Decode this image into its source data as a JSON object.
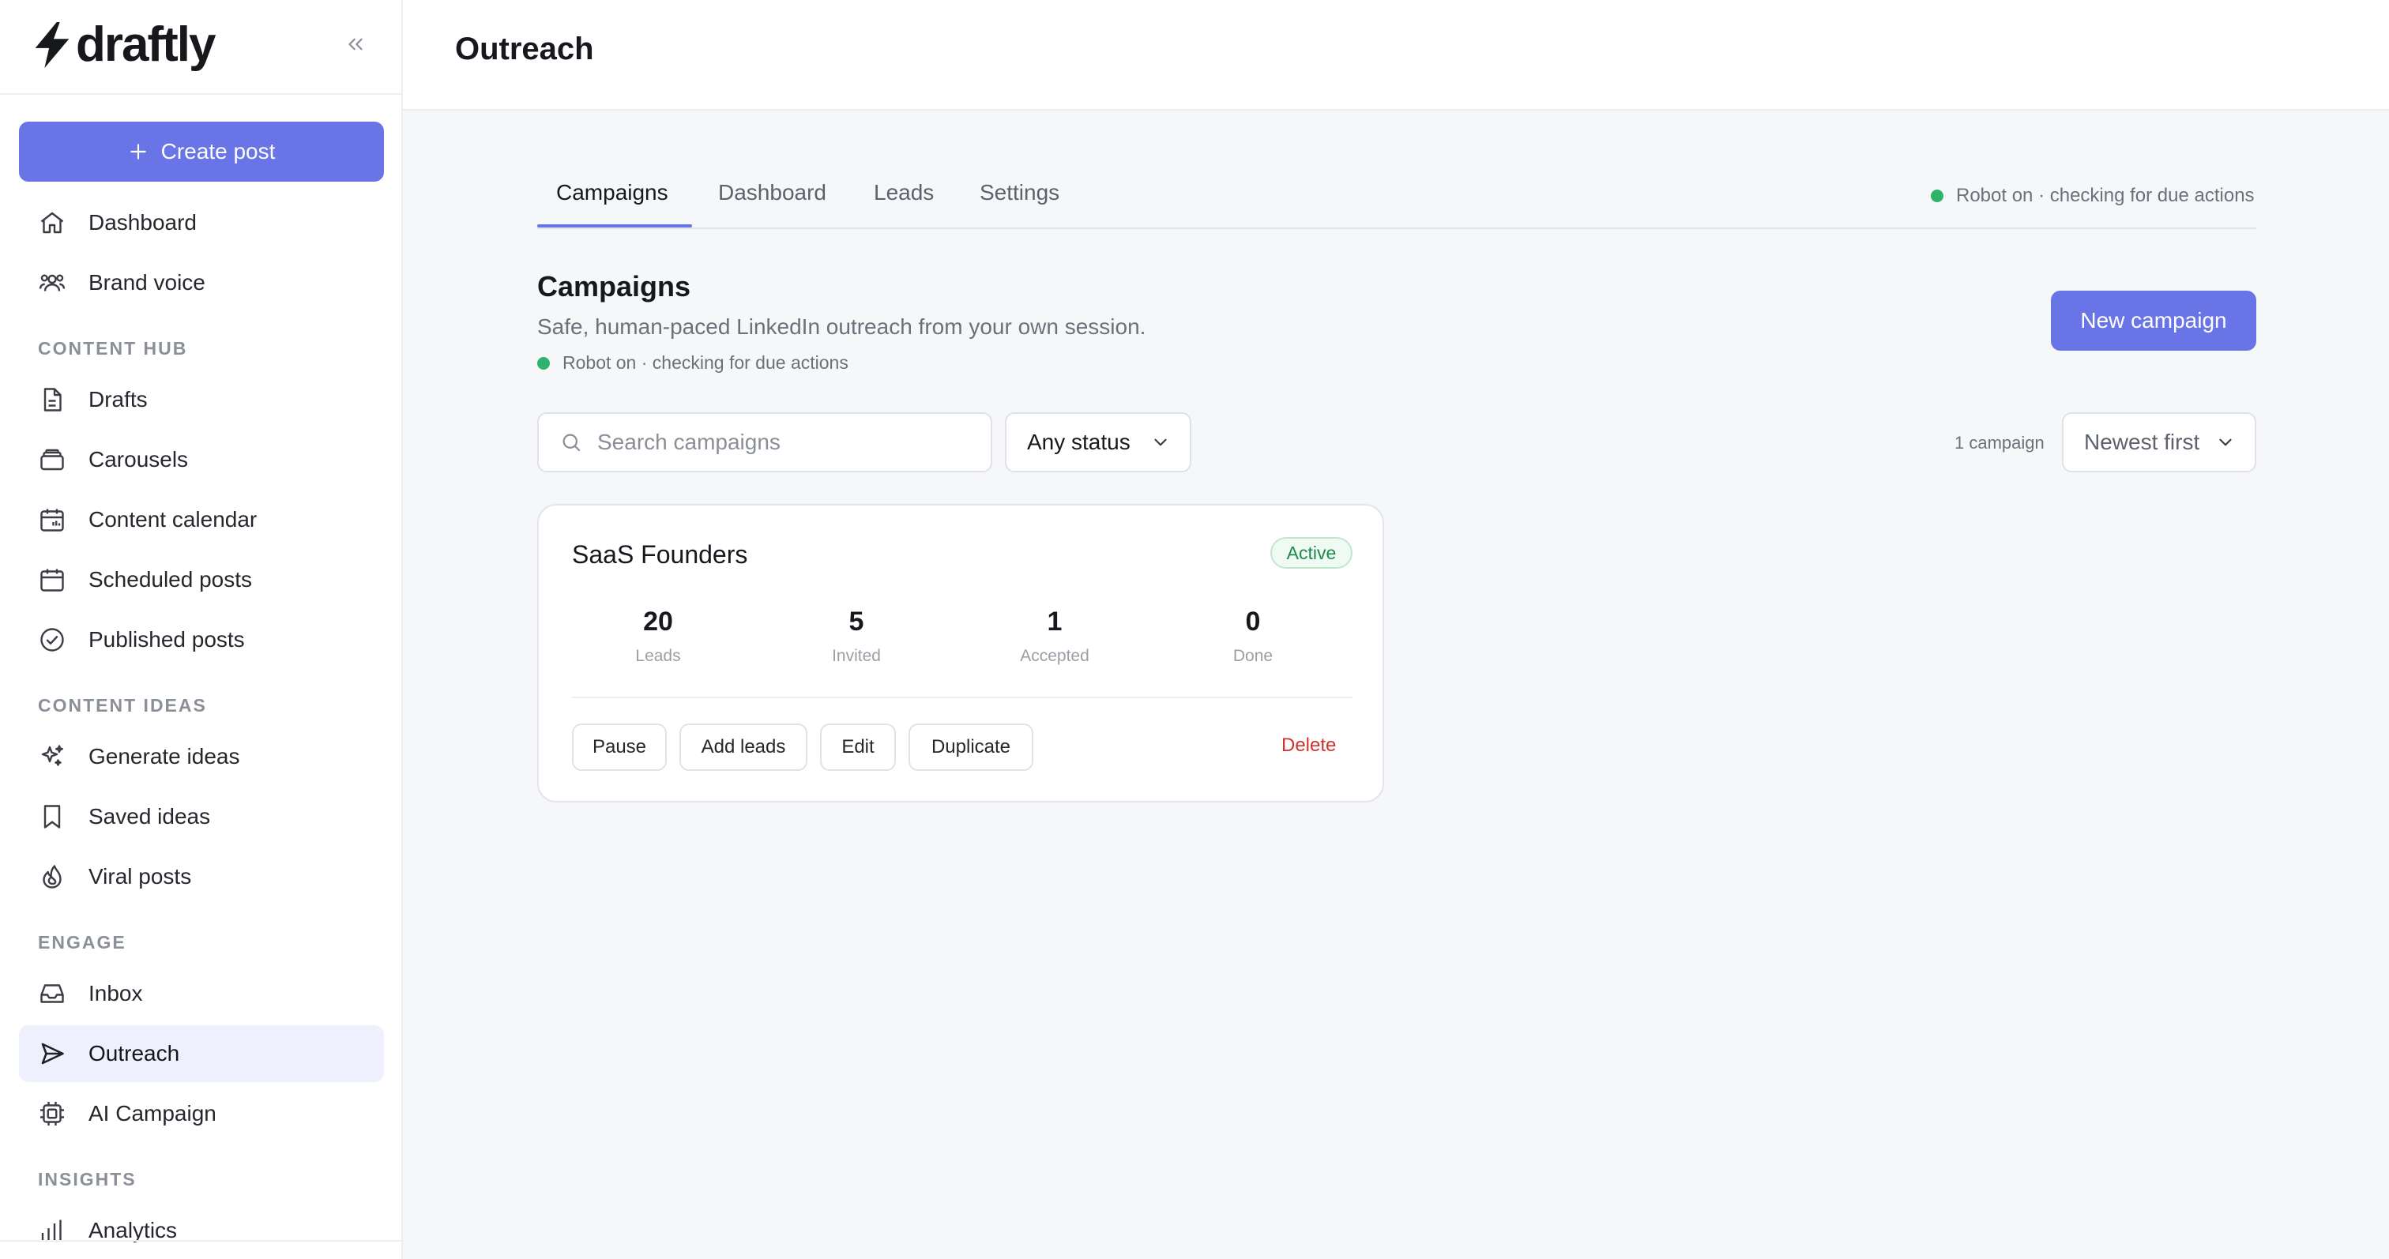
{
  "app": {
    "logo_text": "draftly"
  },
  "sidebar": {
    "create_label": "Create post",
    "top_items": [
      {
        "label": "Dashboard",
        "icon": "home-icon"
      },
      {
        "label": "Brand voice",
        "icon": "users-icon"
      }
    ],
    "sections": [
      {
        "title": "CONTENT HUB",
        "items": [
          {
            "label": "Drafts",
            "icon": "document-icon"
          },
          {
            "label": "Carousels",
            "icon": "layers-icon"
          },
          {
            "label": "Content calendar",
            "icon": "calendar-grid-icon"
          },
          {
            "label": "Scheduled posts",
            "icon": "calendar-icon"
          },
          {
            "label": "Published posts",
            "icon": "check-circle-icon"
          }
        ]
      },
      {
        "title": "CONTENT IDEAS",
        "items": [
          {
            "label": "Generate ideas",
            "icon": "sparkles-icon"
          },
          {
            "label": "Saved ideas",
            "icon": "bookmark-icon"
          },
          {
            "label": "Viral posts",
            "icon": "flame-icon"
          }
        ]
      },
      {
        "title": "ENGAGE",
        "items": [
          {
            "label": "Inbox",
            "icon": "inbox-icon"
          },
          {
            "label": "Outreach",
            "icon": "send-icon",
            "active": true
          },
          {
            "label": "AI Campaign",
            "icon": "chip-icon"
          }
        ]
      },
      {
        "title": "INSIGHTS",
        "items": [
          {
            "label": "Analytics",
            "icon": "bar-chart-icon"
          }
        ]
      }
    ]
  },
  "header": {
    "title": "Outreach"
  },
  "tabs": [
    "Campaigns",
    "Dashboard",
    "Leads",
    "Settings"
  ],
  "robot_status": "Robot on · checking for due actions",
  "campaigns": {
    "title": "Campaigns",
    "subtitle": "Safe, human-paced LinkedIn outreach from your own session.",
    "new_button": "New campaign",
    "search_placeholder": "Search campaigns",
    "status_filter": "Any status",
    "count": "1 campaign",
    "sort": "Newest first",
    "items": [
      {
        "name": "SaaS Founders",
        "status": "Active",
        "stats": [
          {
            "value": "20",
            "label": "Leads"
          },
          {
            "value": "5",
            "label": "Invited"
          },
          {
            "value": "1",
            "label": "Accepted"
          },
          {
            "value": "0",
            "label": "Done"
          }
        ],
        "actions": [
          "Pause",
          "Add leads",
          "Edit",
          "Duplicate"
        ],
        "delete_label": "Delete"
      }
    ]
  },
  "colors": {
    "accent": "#6974e6",
    "active_nav_bg": "#eef0fd",
    "status_green": "#2fb36b",
    "danger": "#d0312d"
  }
}
